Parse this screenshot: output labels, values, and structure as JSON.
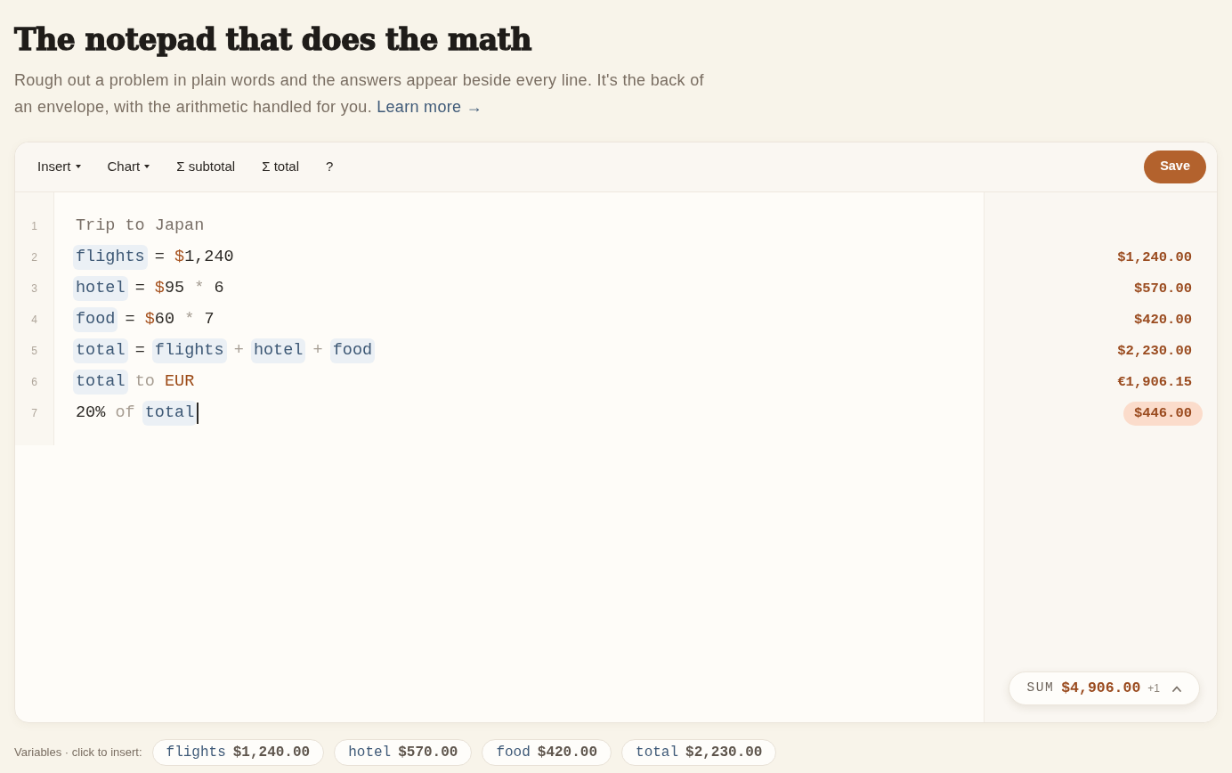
{
  "header": {
    "title": "The notepad that does the math",
    "description": "Rough out a problem in plain words and the answers appear beside every line. It's the back of an envelope, with the arithmetic handled for you.",
    "link": "Learn more →"
  },
  "toolbar": {
    "items": [
      {
        "label": "Insert",
        "dropdown": true
      },
      {
        "label": "Chart",
        "dropdown": true
      },
      {
        "label": "Σ subtotal",
        "dropdown": false
      },
      {
        "label": "Σ total",
        "dropdown": false
      },
      {
        "label": "?",
        "dropdown": false
      }
    ],
    "save": "Save"
  },
  "lines": [
    {
      "number": "1",
      "active": false,
      "tokens": [
        {
          "kind": "heading",
          "text": "Trip to Japan"
        }
      ]
    },
    {
      "number": "2",
      "active": false,
      "tokens": [
        {
          "kind": "variable",
          "text": "flights"
        },
        {
          "kind": "assign",
          "text": "="
        },
        {
          "kind": "money",
          "symbol": "$",
          "amount": "1,240"
        }
      ],
      "result": "$1,240.00"
    },
    {
      "number": "3",
      "active": false,
      "tokens": [
        {
          "kind": "variable",
          "text": "hotel"
        },
        {
          "kind": "assign",
          "text": "="
        },
        {
          "kind": "money",
          "symbol": "$",
          "amount": "95"
        },
        {
          "kind": "operator",
          "text": "*"
        },
        {
          "kind": "number",
          "text": "6"
        }
      ],
      "result": "$570.00"
    },
    {
      "number": "4",
      "active": false,
      "tokens": [
        {
          "kind": "variable",
          "text": "food"
        },
        {
          "kind": "assign",
          "text": "="
        },
        {
          "kind": "money",
          "symbol": "$",
          "amount": "60"
        },
        {
          "kind": "operator",
          "text": "*"
        },
        {
          "kind": "number",
          "text": "7"
        }
      ],
      "result": "$420.00"
    },
    {
      "number": "5",
      "active": false,
      "tokens": [
        {
          "kind": "variable",
          "text": "total"
        },
        {
          "kind": "assign",
          "text": "="
        },
        {
          "kind": "variable",
          "text": "flights"
        },
        {
          "kind": "operator",
          "text": "+"
        },
        {
          "kind": "variable",
          "text": "hotel"
        },
        {
          "kind": "operator",
          "text": "+"
        },
        {
          "kind": "variable",
          "text": "food"
        }
      ],
      "result": "$2,230.00"
    },
    {
      "number": "6",
      "active": false,
      "tokens": [
        {
          "kind": "variable",
          "text": "total"
        },
        {
          "kind": "keyword",
          "text": "to"
        },
        {
          "kind": "unit",
          "text": "EUR"
        }
      ],
      "result": "€1,906.15"
    },
    {
      "number": "7",
      "active": true,
      "tokens": [
        {
          "kind": "number",
          "text": "20%"
        },
        {
          "kind": "keyword",
          "text": "of"
        },
        {
          "kind": "variable",
          "text": "total"
        }
      ],
      "result": "$446.00"
    }
  ],
  "sum": {
    "label": "SUM",
    "value": "$4,906.00",
    "extra": "+1"
  },
  "variables": {
    "label": "Variables · click to insert:",
    "items": [
      {
        "name": "flights",
        "value": "$1,240.00"
      },
      {
        "name": "hotel",
        "value": "$570.00"
      },
      {
        "name": "food",
        "value": "$420.00"
      },
      {
        "name": "total",
        "value": "$2,230.00"
      }
    ]
  }
}
